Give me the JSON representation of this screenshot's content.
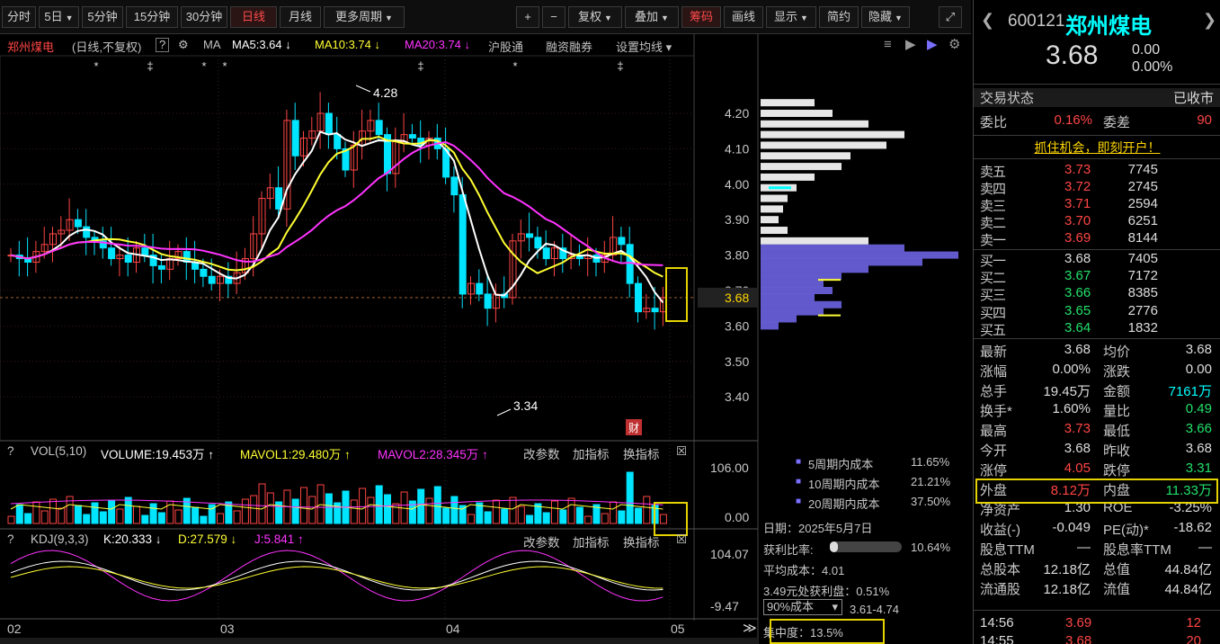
{
  "toolbar": {
    "items": [
      {
        "label": "分时",
        "arrow": false,
        "active": false
      },
      {
        "label": "5日",
        "arrow": true,
        "active": false
      },
      {
        "label": "5分钟",
        "arrow": false,
        "active": false
      },
      {
        "label": "15分钟",
        "arrow": false,
        "active": false
      },
      {
        "label": "30分钟",
        "arrow": false,
        "active": false
      },
      {
        "label": "日线",
        "arrow": false,
        "active": true
      },
      {
        "label": "月线",
        "arrow": false,
        "active": false
      },
      {
        "label": "更多周期",
        "arrow": true,
        "active": false
      }
    ],
    "right": [
      {
        "label": "+",
        "arrow": false,
        "active": false
      },
      {
        "label": "−",
        "arrow": false,
        "active": false
      },
      {
        "label": "复权",
        "arrow": true,
        "active": false
      },
      {
        "label": "叠加",
        "arrow": true,
        "active": false
      },
      {
        "label": "筹码",
        "arrow": false,
        "active": true
      },
      {
        "label": "画线",
        "arrow": false,
        "active": false
      },
      {
        "label": "显示",
        "arrow": true,
        "active": false
      },
      {
        "label": "简约",
        "arrow": false,
        "active": false
      },
      {
        "label": "隐藏",
        "arrow": true,
        "active": false
      }
    ]
  },
  "info": {
    "name": "郑州煤电",
    "mode": "(日线,不复权)",
    "ma": "MA",
    "ma5": "MA5:3.64 ↓",
    "ma10": "MA10:3.74 ↓",
    "ma20": "MA20:3.74 ↓",
    "link1": "沪股通",
    "link2": "融资融券",
    "setting": "设置均线"
  },
  "colors": {
    "up": "#ff4545",
    "down": "#00e5ff",
    "ma5": "#ffffff",
    "ma10": "#ffff33",
    "ma20": "#ff33ff"
  },
  "price_axis": [
    "4.20",
    "4.10",
    "4.00",
    "3.90",
    "3.80",
    "3.70",
    "3.60",
    "3.50",
    "3.40"
  ],
  "current_price_label": "3.68",
  "hi_label": "4.28",
  "lo_label": "3.34",
  "cai_badge": "财",
  "vol_panel": {
    "title": "VOL(5,10)",
    "volume": "VOLUME:19.453万 ↑",
    "mavol1": "MAVOL1:29.480万 ↑",
    "mavol2": "MAVOL2:28.345万 ↑",
    "btn1": "改参数",
    "btn2": "加指标",
    "btn3": "换指标",
    "axis_top": "106.00",
    "axis_bot": "0.00"
  },
  "kdj_panel": {
    "title": "KDJ(9,3,3)",
    "k": "K:20.333 ↓",
    "d": "D:27.579 ↓",
    "j": "J:5.841 ↑",
    "btn1": "改参数",
    "btn2": "加指标",
    "btn3": "换指标",
    "axis_top": "104.07",
    "axis_bot": "-9.47"
  },
  "months": [
    "02",
    "03",
    "04",
    "05"
  ],
  "chip": {
    "rows": [
      {
        "label": "5周期内成本",
        "val": "11.65%"
      },
      {
        "label": "10周期内成本",
        "val": "21.21%"
      },
      {
        "label": "20周期内成本",
        "val": "37.50%"
      }
    ],
    "date": "日期：2025年5月7日",
    "profit_label": "获利比率:",
    "profit_val": "10.64%",
    "profit_ratio": 0.1064,
    "avg_cost": "平均成本：4.01",
    "pos_profit": "3.49元处获利盘：0.51%",
    "cost_select": "90%成本",
    "cost_range": "3.61-4.74",
    "concentration": "集中度：13.5%"
  },
  "quote": {
    "code": "600121",
    "name": "郑州煤电",
    "price": "3.68",
    "change": "0.00",
    "pct": "0.00%",
    "status_label": "交易状态",
    "status": "已收市",
    "weibi_label": "委比",
    "weibi": "0.16%",
    "weicha_label": "委差",
    "weicha": "90",
    "ad": "抓住机会，即刻开户！",
    "asks": [
      {
        "label": "卖五",
        "price": "3.73",
        "vol": "7745"
      },
      {
        "label": "卖四",
        "price": "3.72",
        "vol": "2745"
      },
      {
        "label": "卖三",
        "price": "3.71",
        "vol": "2594"
      },
      {
        "label": "卖二",
        "price": "3.70",
        "vol": "6251"
      },
      {
        "label": "卖一",
        "price": "3.69",
        "vol": "8144"
      }
    ],
    "bids": [
      {
        "label": "买一",
        "price": "3.68",
        "vol": "7405"
      },
      {
        "label": "买二",
        "price": "3.67",
        "vol": "7172"
      },
      {
        "label": "买三",
        "price": "3.66",
        "vol": "8385"
      },
      {
        "label": "买四",
        "price": "3.65",
        "vol": "2776"
      },
      {
        "label": "买五",
        "price": "3.64",
        "vol": "1832"
      }
    ],
    "stats": [
      [
        "最新",
        "3.68",
        "white",
        "均价",
        "3.68",
        "white"
      ],
      [
        "涨幅",
        "0.00%",
        "white",
        "涨跌",
        "0.00",
        "white"
      ],
      [
        "总手",
        "19.45万",
        "white",
        "金额",
        "7161万",
        "cyan"
      ],
      [
        "换手*",
        "1.60%",
        "white",
        "量比",
        "0.49",
        "green"
      ],
      [
        "最高",
        "3.73",
        "red",
        "最低",
        "3.66",
        "green"
      ],
      [
        "今开",
        "3.68",
        "white",
        "昨收",
        "3.68",
        "white"
      ],
      [
        "涨停",
        "4.05",
        "red",
        "跌停",
        "3.31",
        "green"
      ],
      [
        "外盘",
        "8.12万",
        "red",
        "内盘",
        "11.33万",
        "green"
      ],
      [
        "净资产",
        "1.30",
        "white",
        "ROE",
        "-3.25%",
        "white"
      ],
      [
        "收益(-)",
        "-0.049",
        "white",
        "PE(动)*",
        "-18.62",
        "white"
      ],
      [
        "股息TTM",
        "—",
        "white",
        "股息率TTM",
        "—",
        "white"
      ],
      [
        "总股本",
        "12.18亿",
        "white",
        "总值",
        "44.84亿",
        "white"
      ],
      [
        "流通股",
        "12.18亿",
        "white",
        "流值",
        "44.84亿",
        "white"
      ]
    ],
    "tick": {
      "time": "14:56",
      "price": "3.69",
      "vol": "12"
    },
    "tick2": {
      "time": "14:55",
      "price": "3.68",
      "vol": "20"
    }
  }
}
